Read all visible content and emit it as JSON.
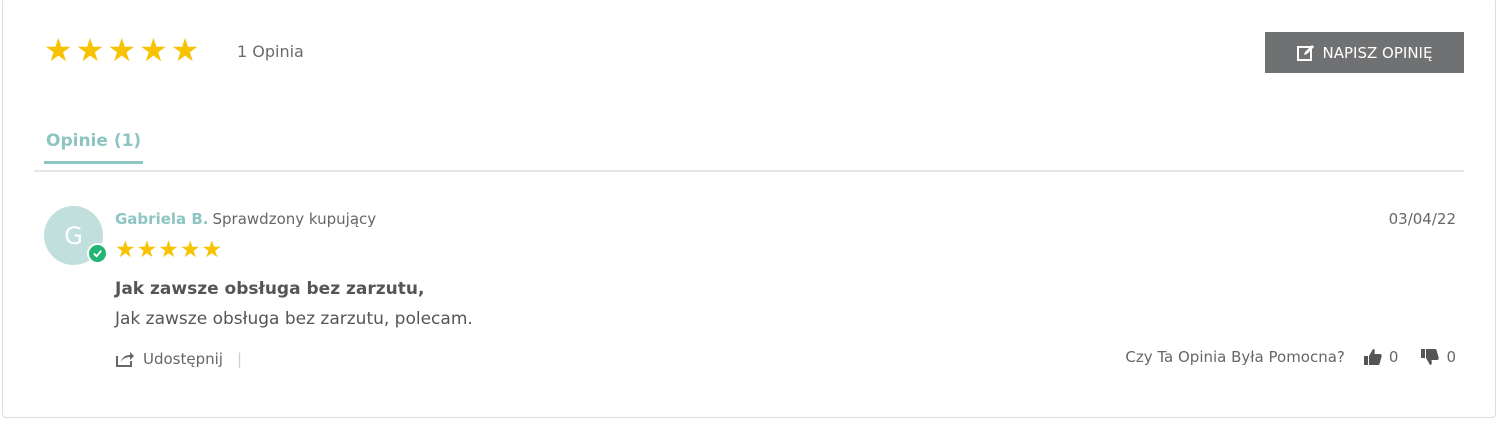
{
  "summary": {
    "rating": 5,
    "stars": [
      "★",
      "★",
      "★",
      "★",
      "★"
    ],
    "review_count": "1 Opinia"
  },
  "write_review": {
    "label": "NAPISZ OPINIĘ",
    "icon": "edit-icon"
  },
  "tabs": [
    {
      "label": "Opinie (1)",
      "active": true
    }
  ],
  "review": {
    "avatar_initial": "G",
    "author": "Gabriela B.",
    "badge": "Sprawdzony kupujący",
    "date": "03/04/22",
    "rating": 5,
    "stars": [
      "★",
      "★",
      "★",
      "★",
      "★"
    ],
    "title": "Jak zawsze obsługa bez zarzutu,",
    "body": "Jak zawsze obsługa bez zarzutu, polecam.",
    "share_label": "Udostępnij",
    "share_separator": "|",
    "helpful_question": "Czy Ta Opinia Była Pomocna?",
    "votes_up": "0",
    "votes_down": "0"
  },
  "colors": {
    "star": "#f7c200",
    "accent": "#8cc5c2",
    "button_bg": "#6f7173",
    "verified": "#22b573"
  }
}
